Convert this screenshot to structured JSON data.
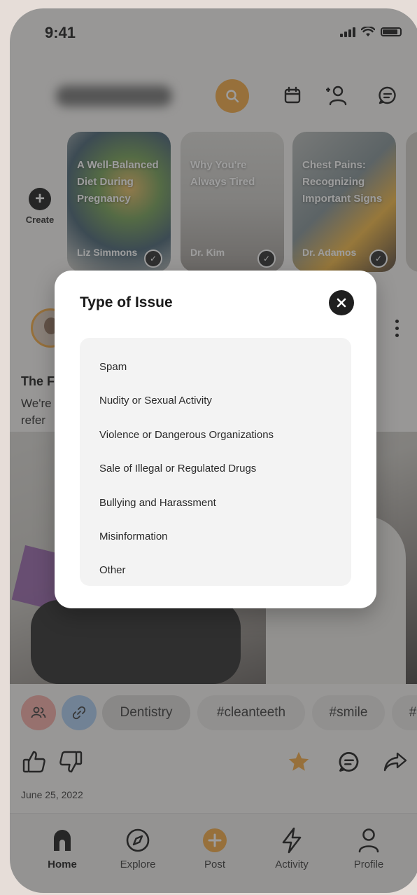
{
  "status_bar": {
    "time": "9:41"
  },
  "header": {
    "icons": [
      "search-icon",
      "calendar-icon",
      "add-user-icon",
      "chat-icon"
    ],
    "accent": "#f2a43a"
  },
  "stories": {
    "create_label": "Create",
    "items": [
      {
        "title": "A Well-Balanced Diet During Pregnancy",
        "author": "Liz Simmons"
      },
      {
        "title": "Why You're Always Tired",
        "author": "Dr. Kim"
      },
      {
        "title": "Chest Pains: Recognizing Important Signs",
        "author": "Dr. Adamos"
      }
    ]
  },
  "post": {
    "title": "The F",
    "body_line1": "We're",
    "body_line2": "refer",
    "date": "June 25, 2022"
  },
  "tags": {
    "chips": [
      "Dentistry",
      "#cleanteeth",
      "#smile",
      "#"
    ]
  },
  "tabbar": {
    "items": [
      {
        "label": "Home",
        "icon": "home-icon",
        "active": true
      },
      {
        "label": "Explore",
        "icon": "compass-icon",
        "active": false
      },
      {
        "label": "Post",
        "icon": "plus-circle-icon",
        "active": false
      },
      {
        "label": "Activity",
        "icon": "lightning-icon",
        "active": false
      },
      {
        "label": "Profile",
        "icon": "person-icon",
        "active": false
      }
    ]
  },
  "modal": {
    "title": "Type of Issue",
    "options": [
      "Spam",
      "Nudity or Sexual Activity",
      "Violence or Dangerous Organizations",
      "Sale of Illegal or Regulated Drugs",
      "Bullying and Harassment",
      "Misinformation",
      "Other"
    ]
  }
}
